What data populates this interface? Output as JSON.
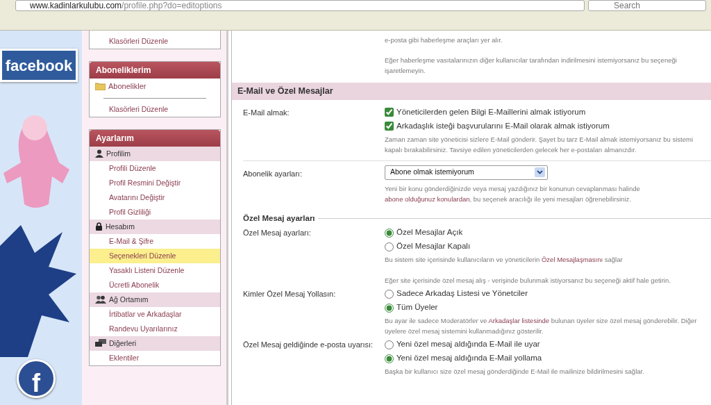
{
  "browser": {
    "url": "www.kadinlarkulubu.com/profile.php?do=editoptions",
    "search_placeholder": "Search"
  },
  "banner": {
    "logo": "facebook",
    "sticker": "f"
  },
  "sidebar": {
    "boxes": [
      {
        "rows": [
          {
            "kind": "item",
            "label": "Klasörleri Düzenle",
            "selected": false
          }
        ]
      },
      {
        "title": "Aboneliklerim",
        "rows": [
          {
            "kind": "folder",
            "label": "Abonelikler"
          },
          {
            "kind": "divider"
          },
          {
            "kind": "item",
            "label": "Klasörleri Düzenle",
            "selected": false
          }
        ]
      },
      {
        "title": "Ayarlarım",
        "rows": [
          {
            "kind": "section",
            "label": "Profilim"
          },
          {
            "kind": "item",
            "label": "Profili Düzenle",
            "selected": false
          },
          {
            "kind": "item",
            "label": "Profil Resmini Değiştir",
            "selected": false
          },
          {
            "kind": "item",
            "label": "Avatarını Değiştir",
            "selected": false
          },
          {
            "kind": "item",
            "label": "Profil Gizliliği",
            "selected": false
          },
          {
            "kind": "section",
            "label": "Hesabım"
          },
          {
            "kind": "item",
            "label": "E-Mail & Şifre",
            "selected": false
          },
          {
            "kind": "item",
            "label": "Seçenekleri Düzenle",
            "selected": true
          },
          {
            "kind": "item",
            "label": "Yasaklı Listeni Düzenle",
            "selected": false
          },
          {
            "kind": "item",
            "label": "Ücretli Abonelik",
            "selected": false
          },
          {
            "kind": "section",
            "label": "Ağ Ortamım"
          },
          {
            "kind": "item",
            "label": "İrtibatlar ve Arkadaşlar",
            "selected": false
          },
          {
            "kind": "item",
            "label": "Randevu Uyarılarınız",
            "selected": false
          },
          {
            "kind": "section",
            "label": "Diğerleri"
          },
          {
            "kind": "item",
            "label": "Eklentiler",
            "selected": false
          }
        ]
      }
    ]
  },
  "intro": [
    "e-posta gibi haberleşme araçları yer alır.",
    "Eğer haberleşme vasıtalarınızın diğer kullanıcılar tarafından indirilmesini istemiyorsanız bu seçeneği işaretlemeyin."
  ],
  "section": {
    "title": "E-Mail ve Özel Mesajlar",
    "rows": [
      {
        "kind": "checkboxes",
        "label": "E-Mail almak:",
        "options": [
          {
            "label": "Yöneticilerden gelen Bilgi E-Maillerini almak istiyorum",
            "checked": true
          },
          {
            "label": "Arkadaşlık isteği başvurularını E-Mail olarak almak istiyorum",
            "checked": true
          }
        ],
        "description": [
          [
            {
              "kind": "text",
              "text": "Zaman zaman site yöneticisi sizlere E-Mail gönderir. Şayet bu tarz E-Mail almak istemiyorsanız bu sistemi kapalı bırakabilirsiniz. Tavsiye edilen yöneticilerden gelecek her e-postaları almanızdır."
            }
          ]
        ]
      },
      {
        "kind": "divider"
      },
      {
        "kind": "select",
        "label": "Abonelik ayarları:",
        "value": "Abone olmak istemiyorum",
        "description": [
          [
            {
              "kind": "text",
              "text": "Yeni bir konu gönderdiğinizde veya mesaj yazdığınız bir konunun cevaplanması halinde "
            },
            {
              "kind": "link",
              "text": "abone olduğunuz konulardan"
            },
            {
              "kind": "text",
              "text": ", bu seçenek aracılığı ile yeni mesajları öğrenebilirsiniz."
            }
          ]
        ]
      },
      {
        "kind": "heading",
        "title": "Özel Mesaj ayarları"
      },
      {
        "kind": "radios",
        "label": "Özel Mesaj ayarları:",
        "options": [
          {
            "label": "Özel Mesajlar Açık",
            "selected": true
          },
          {
            "label": "Özel Mesajlar Kapalı",
            "selected": false
          }
        ],
        "description": [
          [
            {
              "kind": "text",
              "text": "Bu sistem site içerisinde kullanıcıların ve yöneticilerin "
            },
            {
              "kind": "link",
              "text": "Özel Mesajlaşmasını"
            },
            {
              "kind": "text",
              "text": " sağlar"
            }
          ],
          [
            {
              "kind": "text",
              "text": "Eğer site içerisinde özel mesaj alış - verişinde bulunmak istiyorsanız bu seçeneği aktif hale getirin."
            }
          ]
        ]
      },
      {
        "kind": "radios",
        "label": "Kimler Özel Mesaj Yollasın:",
        "options": [
          {
            "label": "Sadece Arkadaş Listesi ve Yönetciler",
            "selected": false
          },
          {
            "label": "Tüm Üyeler",
            "selected": true
          }
        ],
        "description": [
          [
            {
              "kind": "text",
              "text": "Bu ayar ile sadece Moderatörler ve "
            },
            {
              "kind": "link",
              "text": "Arkadaşlar listesinde"
            },
            {
              "kind": "text",
              "text": " bulunan üyeler size özel mesaj gönderebilir. Diğer üyelere özel mesaj sistemini kullanmadığınız gösterilir."
            }
          ]
        ]
      },
      {
        "kind": "radios",
        "label": "Özel Mesaj geldiğinde e-posta uyarısı:",
        "options": [
          {
            "label": "Yeni özel mesaj aldığında E-Mail ile uyar",
            "selected": false
          },
          {
            "label": "Yeni özel mesaj aldığında E-Mail yollama",
            "selected": true
          }
        ],
        "description": [
          [
            {
              "kind": "text",
              "text": "Başka bir kullanıcı size özel mesaj gönderdiğinde E-Mail ile mailinize bildirilmesini sağlar."
            }
          ]
        ]
      }
    ]
  }
}
